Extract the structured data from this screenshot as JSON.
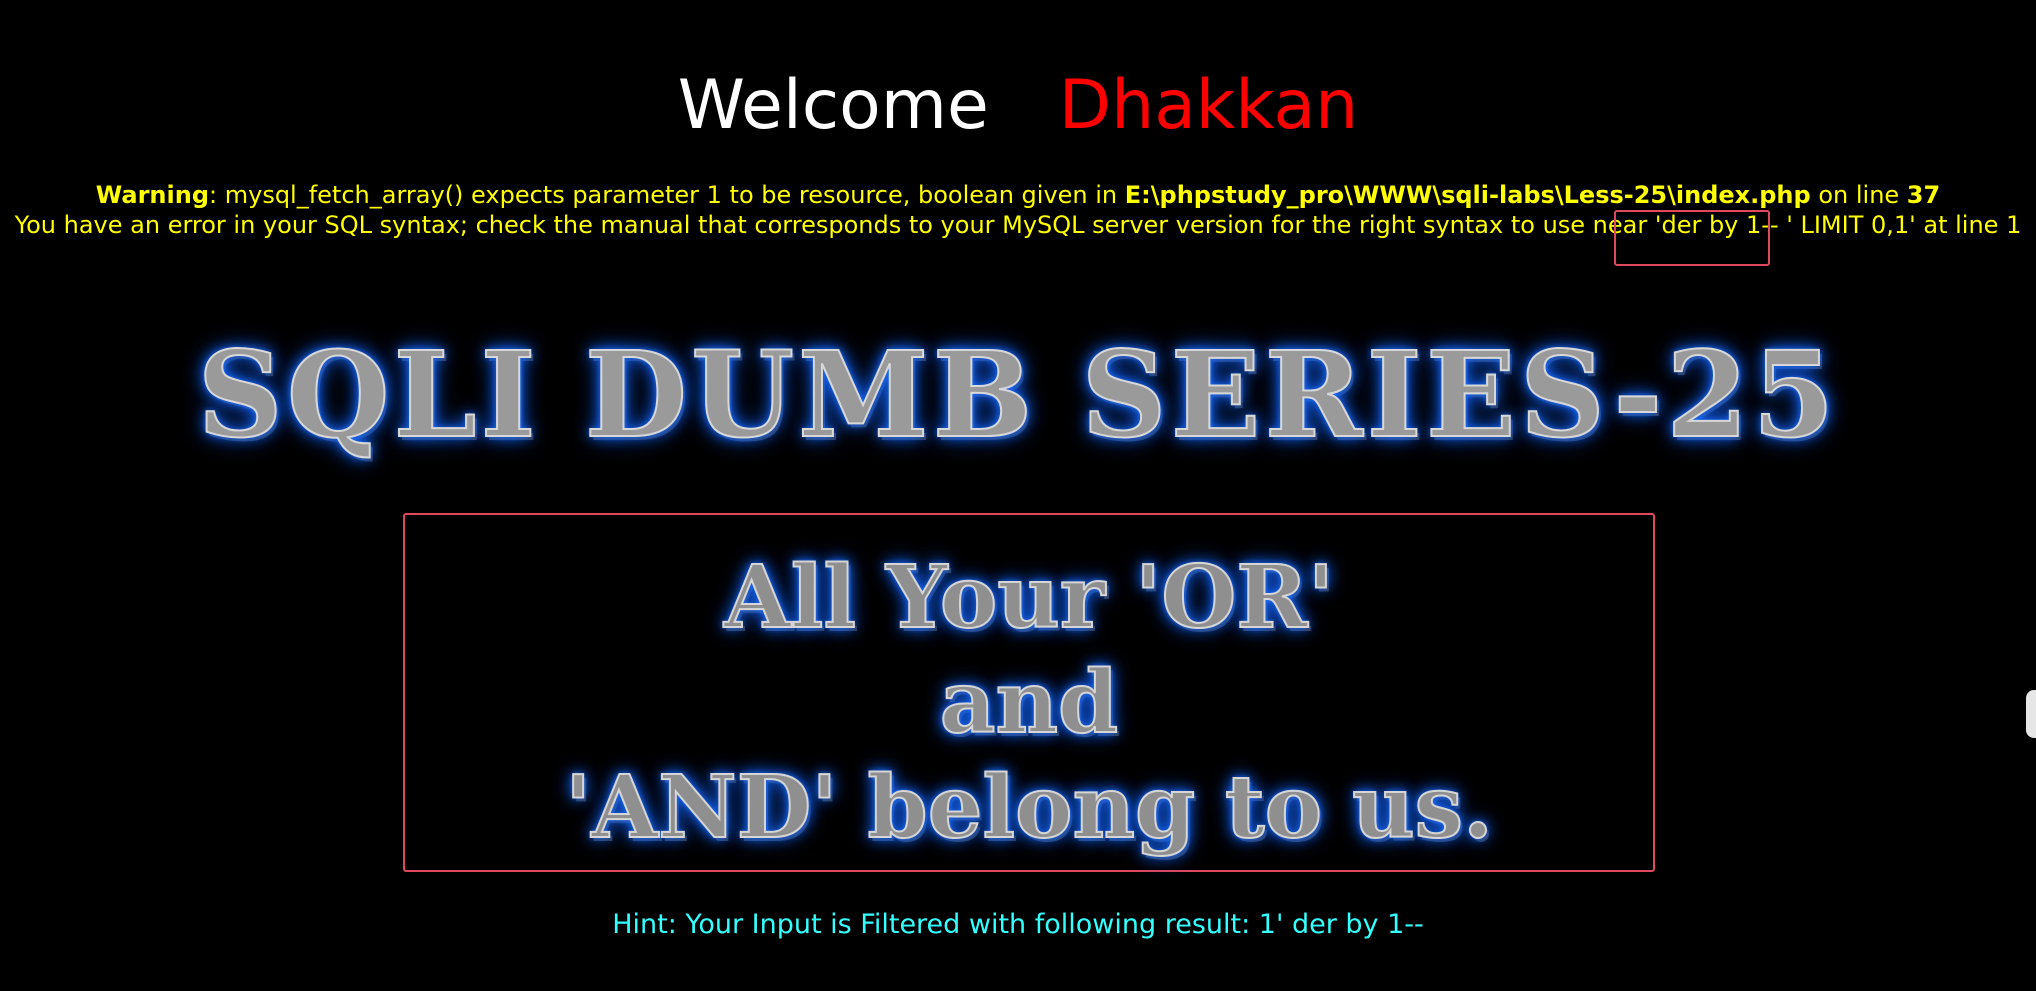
{
  "header": {
    "welcome_text": "Welcome",
    "welcome_name": "Dhakkan"
  },
  "warning": {
    "label": "Warning",
    "message": ": mysql_fetch_array() expects parameter 1 to be resource, boolean given in ",
    "file_path": "E:\\phpstudy_pro\\WWW\\sqli-labs\\Less-25\\index.php",
    "line_prefix": " on line ",
    "line_number": "37"
  },
  "error": {
    "message": "You have an error in your SQL syntax; check the manual that corresponds to your MySQL server version for the right syntax to use near 'der by 1-- ' LIMIT 0,1' at line 1"
  },
  "banner": {
    "title": "SQLI DUMB SERIES-25"
  },
  "box": {
    "line1": "All Your 'OR'",
    "line2": "and",
    "line3": "'AND' belong to us."
  },
  "hint": {
    "text": "Hint: Your Input is Filtered with following result: 1' der by 1--"
  },
  "colors": {
    "background": "#000000",
    "warning_text": "#ffff00",
    "welcome_name": "#ff0000",
    "hint_text": "#33ffff",
    "highlight_border": "#e0485e",
    "glow": "#1a6bff"
  }
}
